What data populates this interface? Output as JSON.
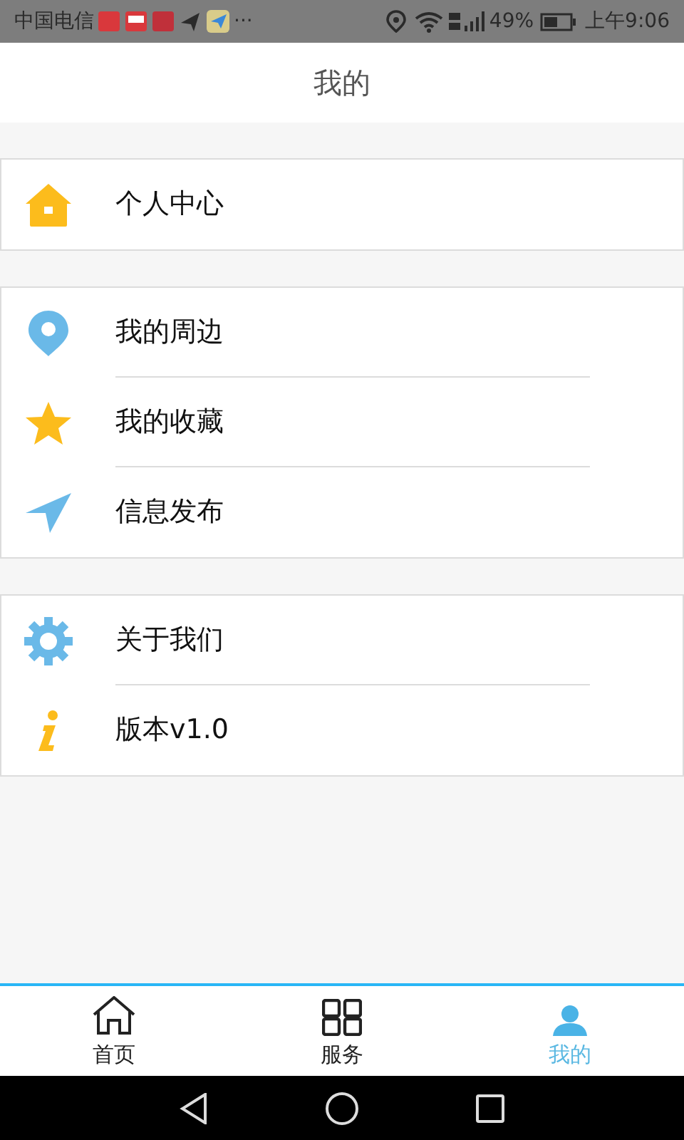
{
  "status_bar": {
    "carrier": "中国电信",
    "more": "···",
    "battery_percent": "49%",
    "time": "上午9:06"
  },
  "header": {
    "title": "我的"
  },
  "groups": [
    [
      {
        "kind": "home",
        "label": "个人中心"
      }
    ],
    [
      {
        "kind": "pin",
        "label": "我的周边"
      },
      {
        "kind": "star",
        "label": "我的收藏"
      },
      {
        "kind": "send",
        "label": "信息发布"
      }
    ],
    [
      {
        "kind": "gear",
        "label": "关于我们"
      },
      {
        "kind": "info",
        "label": "版本v1.0"
      }
    ]
  ],
  "tabs": [
    {
      "kind": "home",
      "label": "首页",
      "selected": false
    },
    {
      "kind": "grid",
      "label": "服务",
      "selected": false
    },
    {
      "kind": "person",
      "label": "我的",
      "selected": true
    }
  ]
}
